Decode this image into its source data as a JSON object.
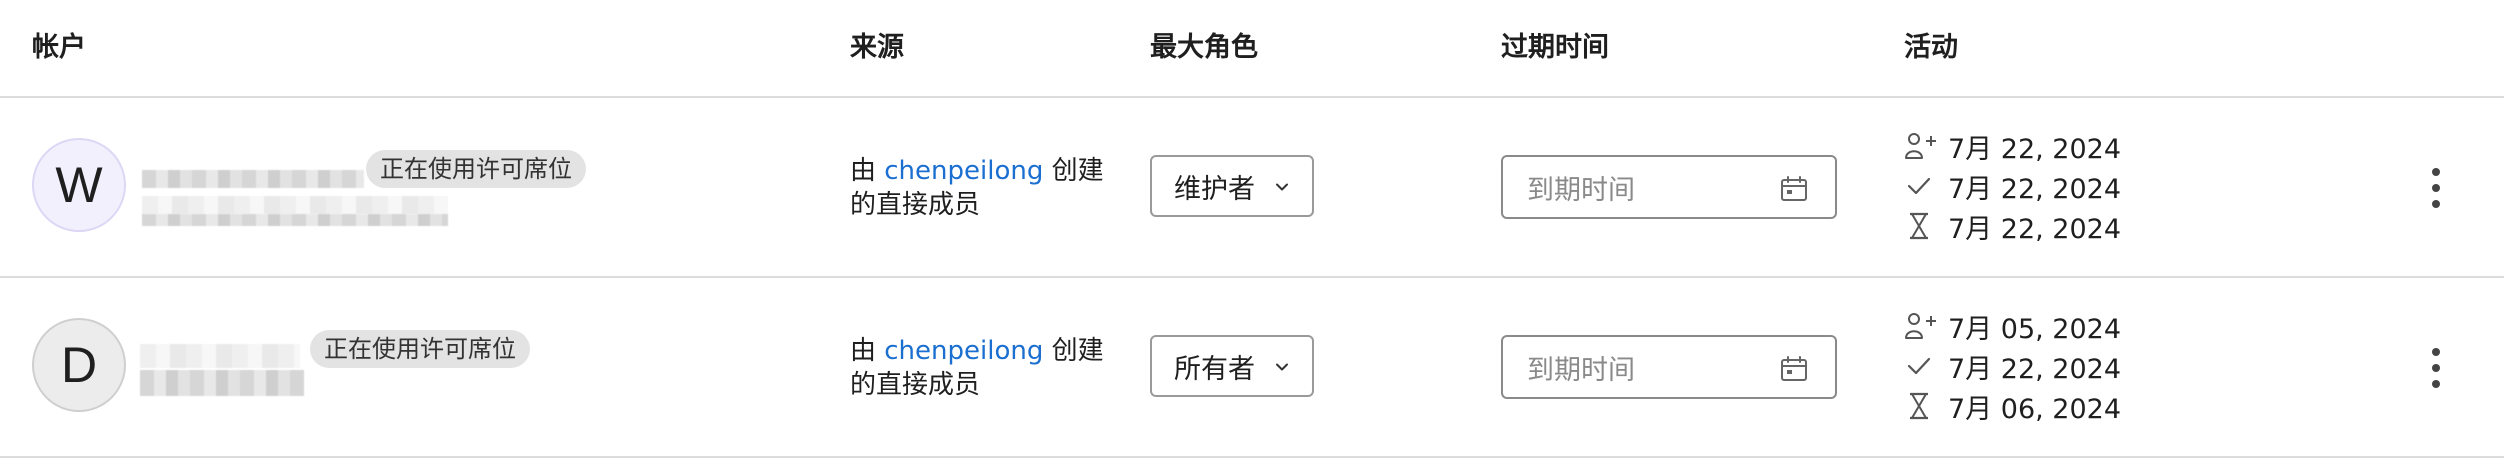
{
  "header": {
    "account": "帐户",
    "source": "来源",
    "max_role": "最大角色",
    "expiration": "过期时间",
    "activity": "活动"
  },
  "rows": [
    {
      "avatar_letter": "W",
      "badge": "正在使用许可席位",
      "source_prefix": "由 ",
      "source_user": "chenpeilong",
      "source_suffix": " 创建的直接成员",
      "role": "维护者",
      "expiry_placeholder": "到期时间",
      "activity": {
        "added": "7月 22, 2024",
        "approved": "7月 22, 2024",
        "last_activity": "7月 22, 2024"
      }
    },
    {
      "avatar_letter": "D",
      "badge": "正在使用许可席位",
      "source_prefix": "由 ",
      "source_user": "chenpeilong",
      "source_suffix": " 创建的直接成员",
      "role": "所有者",
      "expiry_placeholder": "到期时间",
      "activity": {
        "added": "7月 05, 2024",
        "approved": "7月 22, 2024",
        "last_activity": "7月 06, 2024"
      }
    }
  ],
  "icons": {
    "added": "user-add-icon",
    "approved": "check-icon",
    "last_activity": "hourglass-icon",
    "expiry": "calendar-icon",
    "role_dropdown": "chevron-down-icon",
    "actions": "more-vertical-icon"
  },
  "colors": {
    "link": "#1a6fd1",
    "badge_bg": "#e3e3e3",
    "divider": "#dcdcdc"
  }
}
